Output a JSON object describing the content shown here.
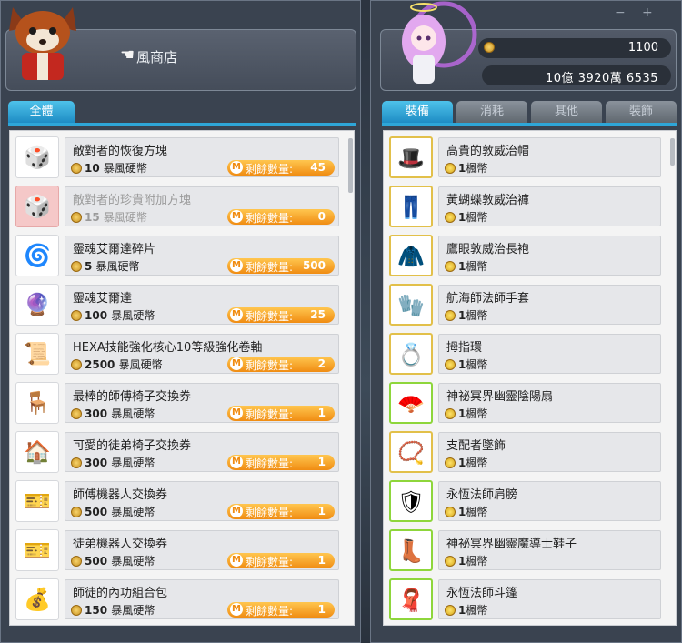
{
  "shop": {
    "title": "風商店"
  },
  "wallet": {
    "coins": "1100",
    "meso": "10億 3920萬 6535"
  },
  "window": {
    "minimize": "−",
    "maximize": "+"
  },
  "left_tabs": [
    {
      "label": "全體",
      "active": true
    }
  ],
  "right_tabs": [
    {
      "label": "裝備",
      "active": true
    },
    {
      "label": "消耗",
      "active": false
    },
    {
      "label": "其他",
      "active": false
    },
    {
      "label": "裝飾",
      "active": false
    }
  ],
  "remain_label": "剩餘數量:",
  "remain_icon": "M",
  "left_items": [
    {
      "name": "敵對者的恢復方塊",
      "price": "10",
      "currency": "暴風硬幣",
      "remaining": "45",
      "icon": "cube-icon",
      "glyph": "🎲"
    },
    {
      "name": "敵對者的珍貴附加方塊",
      "price": "15",
      "currency": "暴風硬幣",
      "remaining": "0",
      "icon": "pink-cube-icon",
      "glyph": "🎲",
      "disabled": true
    },
    {
      "name": "靈魂艾爾達碎片",
      "price": "5",
      "currency": "暴風硬幣",
      "remaining": "500",
      "icon": "soul-shard-icon",
      "glyph": "🌀"
    },
    {
      "name": "靈魂艾爾達",
      "price": "100",
      "currency": "暴風硬幣",
      "remaining": "25",
      "icon": "soul-erda-icon",
      "glyph": "🔮"
    },
    {
      "name": "HEXA技能強化核心10等級強化卷軸",
      "price": "2500",
      "currency": "暴風硬幣",
      "remaining": "2",
      "icon": "scroll-icon",
      "glyph": "📜"
    },
    {
      "name": "最棒的師傅椅子交換券",
      "price": "300",
      "currency": "暴風硬幣",
      "remaining": "1",
      "icon": "chair-icon",
      "glyph": "🪑"
    },
    {
      "name": "可愛的徒弟椅子交換券",
      "price": "300",
      "currency": "暴風硬幣",
      "remaining": "1",
      "icon": "house-chair-icon",
      "glyph": "🏠"
    },
    {
      "name": "師傅機器人交換券",
      "price": "500",
      "currency": "暴風硬幣",
      "remaining": "1",
      "icon": "ticket-icon",
      "glyph": "🎫"
    },
    {
      "name": "徒弟機器人交換券",
      "price": "500",
      "currency": "暴風硬幣",
      "remaining": "1",
      "icon": "ticket-icon",
      "glyph": "🎫"
    },
    {
      "name": "師徒的內功組合包",
      "price": "150",
      "currency": "暴風硬幣",
      "remaining": "1",
      "icon": "bag-icon",
      "glyph": "💰"
    }
  ],
  "right_items": [
    {
      "name": "高貴的敦威治帽",
      "price": "1",
      "currency": "楓幣",
      "icon": "hat-icon",
      "glyph": "🎩",
      "frame": "gold"
    },
    {
      "name": "黃蝴蝶敦威治褲",
      "price": "1",
      "currency": "楓幣",
      "icon": "pants-icon",
      "glyph": "👖",
      "frame": "gold"
    },
    {
      "name": "鷹眼敦威治長袍",
      "price": "1",
      "currency": "楓幣",
      "icon": "robe-icon",
      "glyph": "🧥",
      "frame": "gold"
    },
    {
      "name": "航海師法師手套",
      "price": "1",
      "currency": "楓幣",
      "icon": "gloves-icon",
      "glyph": "🧤",
      "frame": "gold"
    },
    {
      "name": "拇指環",
      "price": "1",
      "currency": "楓幣",
      "icon": "ring-icon",
      "glyph": "💍",
      "frame": "gold"
    },
    {
      "name": "神祕冥界幽靈陰陽扇",
      "price": "1",
      "currency": "楓幣",
      "icon": "fan-icon",
      "glyph": "🪭",
      "frame": "green"
    },
    {
      "name": "支配者墜飾",
      "price": "1",
      "currency": "楓幣",
      "icon": "pendant-icon",
      "glyph": "📿",
      "frame": "gold"
    },
    {
      "name": "永恆法師肩膀",
      "price": "1",
      "currency": "楓幣",
      "icon": "shoulder-icon",
      "glyph": "🛡",
      "frame": "green"
    },
    {
      "name": "神祕冥界幽靈魔導士鞋子",
      "price": "1",
      "currency": "楓幣",
      "icon": "shoes-icon",
      "glyph": "👢",
      "frame": "green"
    },
    {
      "name": "永恆法師斗篷",
      "price": "1",
      "currency": "楓幣",
      "icon": "cape-icon",
      "glyph": "🧣",
      "frame": "green"
    }
  ]
}
